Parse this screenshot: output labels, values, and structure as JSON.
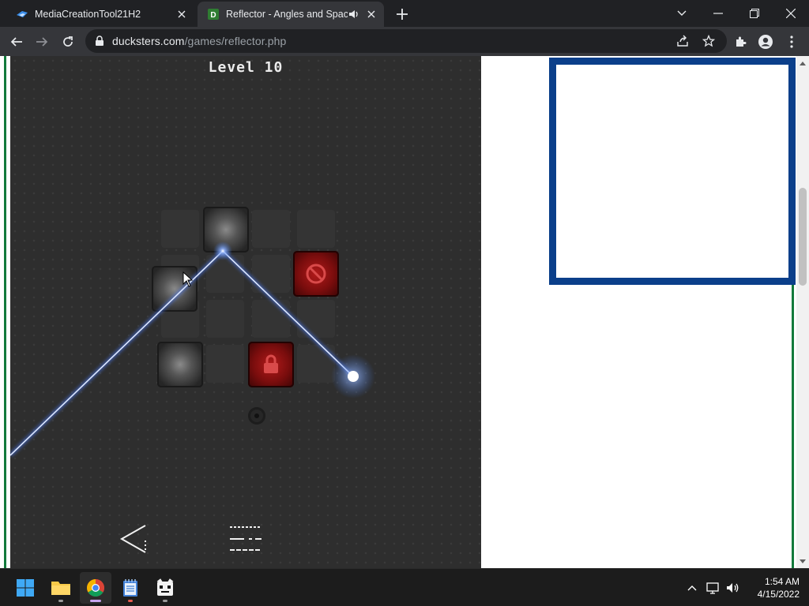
{
  "browser": {
    "tabs": [
      {
        "title": "MediaCreationTool21H2",
        "active": false
      },
      {
        "title": "Reflector - Angles and Spacing",
        "active": true,
        "audio": true
      }
    ],
    "url_host": "ducksters.com",
    "url_path": "/games/reflector.php"
  },
  "game": {
    "level_label": "Level 10"
  },
  "taskbar": {
    "apps": [
      "start",
      "file-explorer",
      "chrome",
      "notepad",
      "game-app"
    ],
    "time": "1:54 AM",
    "date": "4/15/2022"
  },
  "colors": {
    "chrome_dark": "#202124",
    "chrome_toolbar": "#35363a",
    "game_bg": "#2e2e2e",
    "beam": "#5b8cff",
    "ad_border": "#0b3f8a",
    "site_green": "#137a3c",
    "blocker_red": "#b11a1a"
  }
}
